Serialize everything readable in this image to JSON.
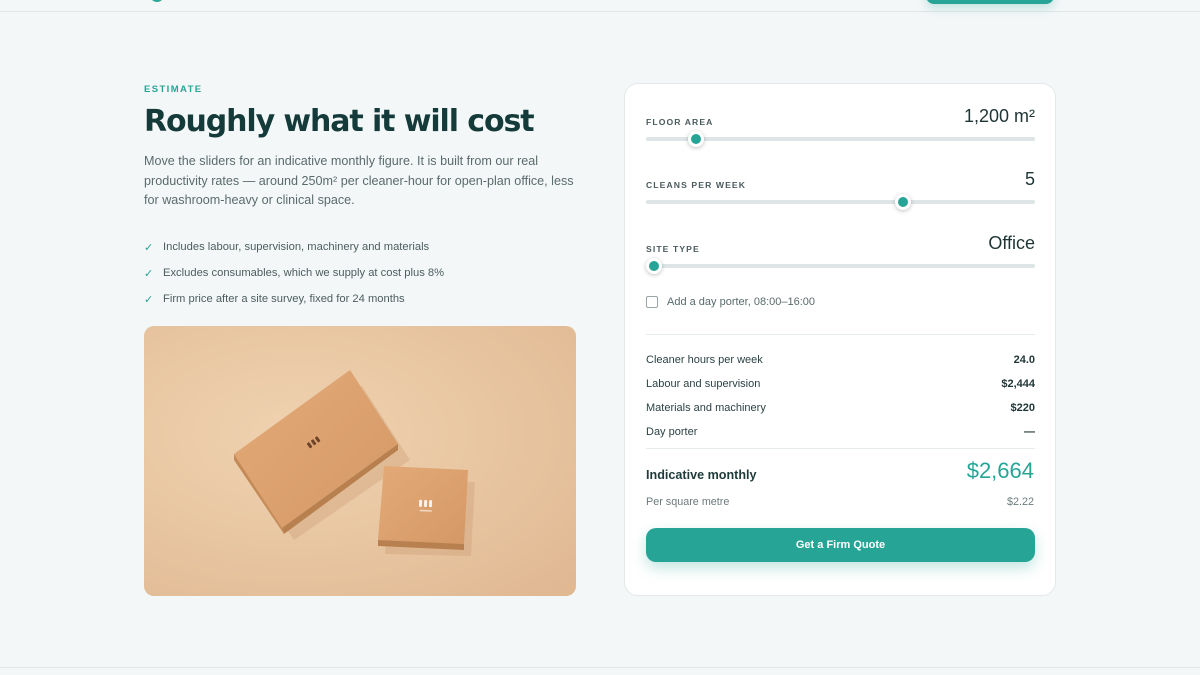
{
  "section": {
    "eyebrow": "ESTIMATE",
    "title": "Roughly what it will cost",
    "lead": "Move the sliders for an indicative monthly figure. It is built from our real productivity rates — around 250m² per cleaner-hour for open-plan office, less for washroom-heavy or clinical space.",
    "features": [
      "Includes labour, supervision, machinery and materials",
      "Excludes consumables, which we supply at cost plus 8%",
      "Firm price after a site survey, fixed for 24 months"
    ],
    "check_icon": "✓"
  },
  "calculator": {
    "floor_area": {
      "label": "FLOOR AREA",
      "value": "1,200 m²",
      "slider_fraction": 0.128
    },
    "cleans_per_week": {
      "label": "CLEANS PER WEEK",
      "value": "5",
      "slider_fraction": 0.661
    },
    "site_type": {
      "label": "SITE TYPE",
      "value": "Office",
      "slider_fraction": 0.02
    },
    "day_porter": {
      "label": "Add a day porter, 08:00–16:00",
      "checked": false
    },
    "rows": [
      {
        "label": "Cleaner hours per week",
        "value": "24.0"
      },
      {
        "label": "Labour and supervision",
        "value": "$2,444"
      },
      {
        "label": "Materials and machinery",
        "value": "$220"
      },
      {
        "label": "Day porter",
        "value": "—"
      }
    ],
    "total": {
      "label": "Indicative monthly",
      "value": "$2,664"
    },
    "per_sqm": {
      "label": "Per square metre",
      "value": "$2.22"
    },
    "cta_label": "Get a Firm Quote"
  },
  "colors": {
    "accent": "#26a596",
    "heading": "#143b3a",
    "background": "#f4f7f8"
  }
}
